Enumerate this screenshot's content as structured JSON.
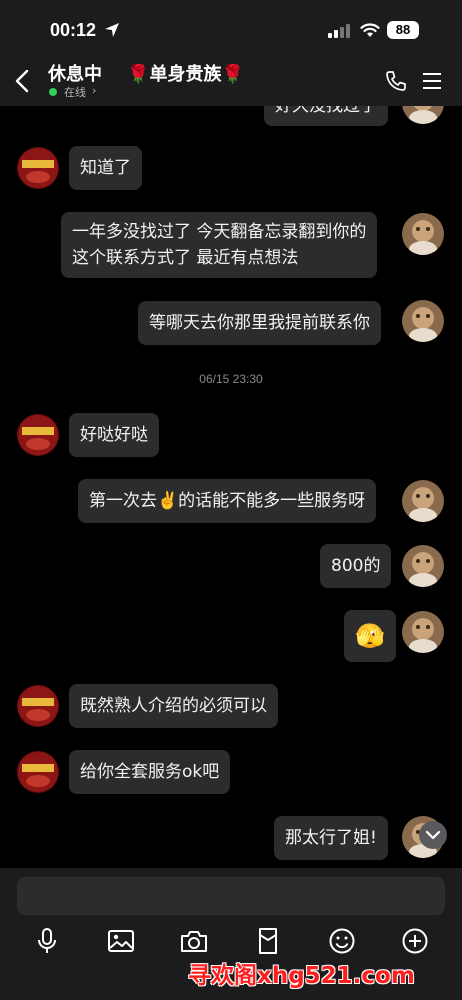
{
  "status_bar": {
    "time": "00:12",
    "battery": "88"
  },
  "header": {
    "contact_name": "休息中    🌹单身贵族🌹",
    "status": "在线",
    "status_chevron": "›"
  },
  "messages": [
    {
      "side": "right",
      "text": "好久没找过了"
    },
    {
      "side": "left",
      "text": "知道了"
    },
    {
      "side": "right",
      "text": "一年多没找过了 今天翻备忘录翻到你的\n这个联系方式了 最近有点想法"
    },
    {
      "side": "right",
      "text": "等哪天去你那里我提前联系你"
    },
    {
      "side": "left",
      "text": "好哒好哒"
    },
    {
      "side": "right",
      "text": "第一次去✌️的话能不能多一些服务呀"
    },
    {
      "side": "right",
      "text": "800的"
    },
    {
      "side": "right",
      "text": "🫣"
    },
    {
      "side": "left",
      "text": "既然熟人介绍的必须可以"
    },
    {
      "side": "left",
      "text": "给你全套服务ok吧"
    },
    {
      "side": "right",
      "text": "那太行了姐!"
    }
  ],
  "timestamp": "06/15 23:30",
  "input": {
    "placeholder": ""
  },
  "toolbar": {
    "icons": [
      "microphone-icon",
      "image-icon",
      "camera-icon",
      "redpacket-icon",
      "emoji-icon",
      "plus-icon"
    ]
  },
  "watermark": "寻欢阁xhg521.com",
  "colors": {
    "background": "#000000",
    "bar": "#1c1c1e",
    "bubble": "#2c2c2e",
    "online": "#30d158",
    "watermark": "#ff1e1e"
  }
}
